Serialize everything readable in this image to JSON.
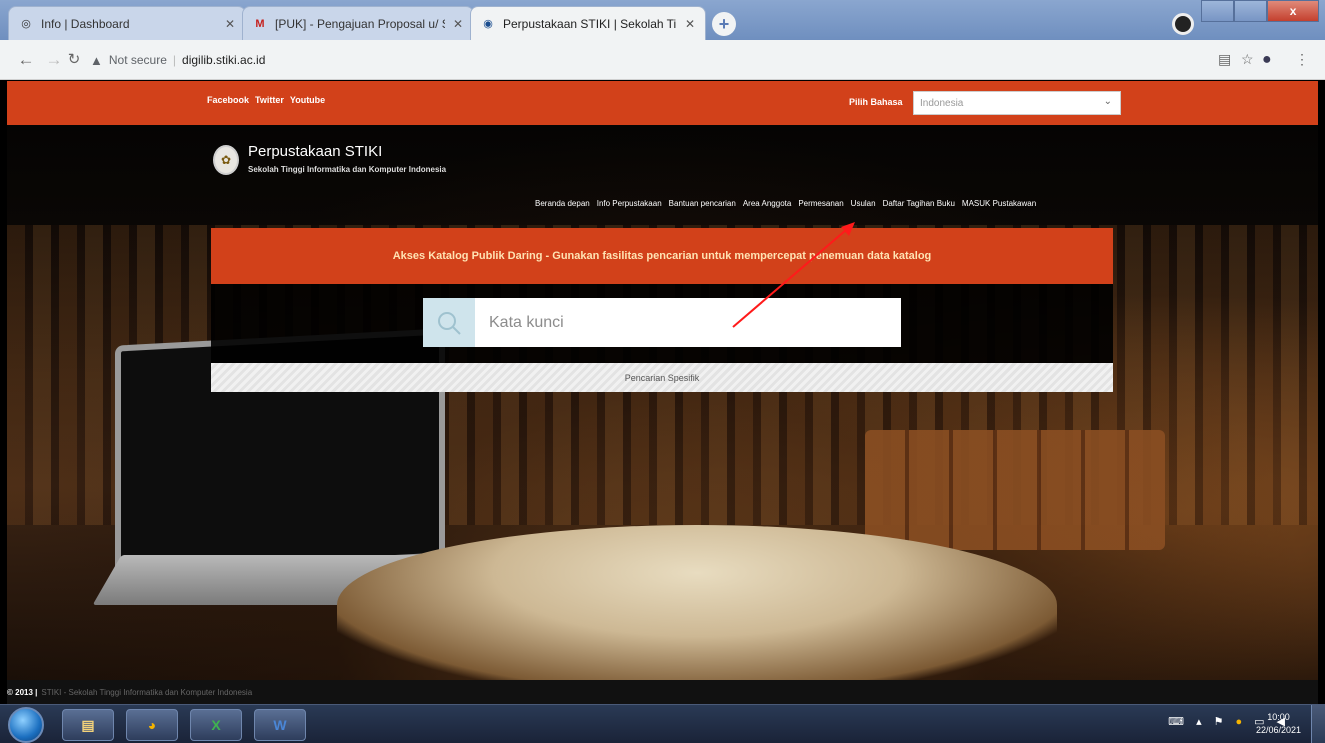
{
  "browser": {
    "tabs": [
      {
        "title": "Info | Dashboard",
        "favicon": "globe-icon",
        "active": false
      },
      {
        "title": "[PUK] - Pengajuan Proposal u/ S",
        "favicon": "gmail-icon",
        "active": false
      },
      {
        "title": "Perpustakaan STIKI | Sekolah Tin",
        "favicon": "library-icon",
        "active": true
      }
    ],
    "security": "Not secure",
    "url": "digilib.stiki.ac.id"
  },
  "site": {
    "social": [
      "Facebook",
      "Twitter",
      "Youtube"
    ],
    "language_label": "Pilih Bahasa",
    "language_value": "Indonesia",
    "brand_title": "Perpustakaan STIKI",
    "brand_subtitle": "Sekolah Tinggi Informatika dan Komputer Indonesia",
    "nav": [
      "Beranda depan",
      "Info Perpustakaan",
      "Bantuan pencarian",
      "Area Anggota",
      "Permesanan",
      "Usulan",
      "Daftar Tagihan Buku",
      "MASUK Pustakawan"
    ],
    "banner": "Akses Katalog Publik Daring - Gunakan fasilitas pencarian untuk mempercepat penemuan data katalog",
    "search_placeholder": "Kata kunci",
    "specific_search": "Pencarian Spesifik",
    "footer_year": "© 2013 |",
    "footer_text": "STIKI - Sekolah Tinggi Informatika dan Komputer Indonesia"
  },
  "taskbar": {
    "clock_time": "10:00",
    "clock_date": "22/06/2021"
  },
  "colors": {
    "brand": "#d2411a",
    "banner_text": "#ffe3b3"
  }
}
